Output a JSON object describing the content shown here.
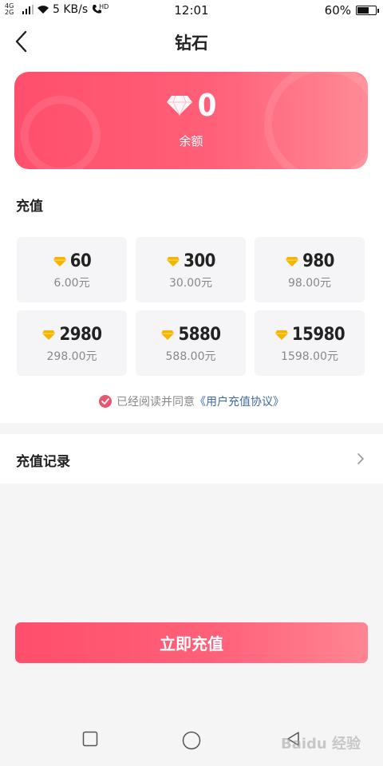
{
  "status_bar": {
    "network": "4G 2G",
    "speed": "5 KB/s",
    "hd": "HD",
    "time": "12:01",
    "battery": "60%",
    "battery_level": 0.6
  },
  "header": {
    "title": "钻石"
  },
  "balance": {
    "value": "0",
    "label": "余额"
  },
  "recharge_section": {
    "title": "充值"
  },
  "options": [
    {
      "amount": "60",
      "price": "6.00元"
    },
    {
      "amount": "300",
      "price": "30.00元"
    },
    {
      "amount": "980",
      "price": "98.00元"
    },
    {
      "amount": "2980",
      "price": "298.00元"
    },
    {
      "amount": "5880",
      "price": "588.00元"
    },
    {
      "amount": "15980",
      "price": "1598.00元"
    }
  ],
  "agreement": {
    "text": "已经阅读并同意",
    "link": "《用户充值协议》"
  },
  "records": {
    "label": "充值记录"
  },
  "action": {
    "label": "立即充值"
  },
  "watermark": "Baidu 经验",
  "colors": {
    "accent": "#ff4f6d",
    "link": "#3f6aa1",
    "gold": "#f5b400"
  }
}
